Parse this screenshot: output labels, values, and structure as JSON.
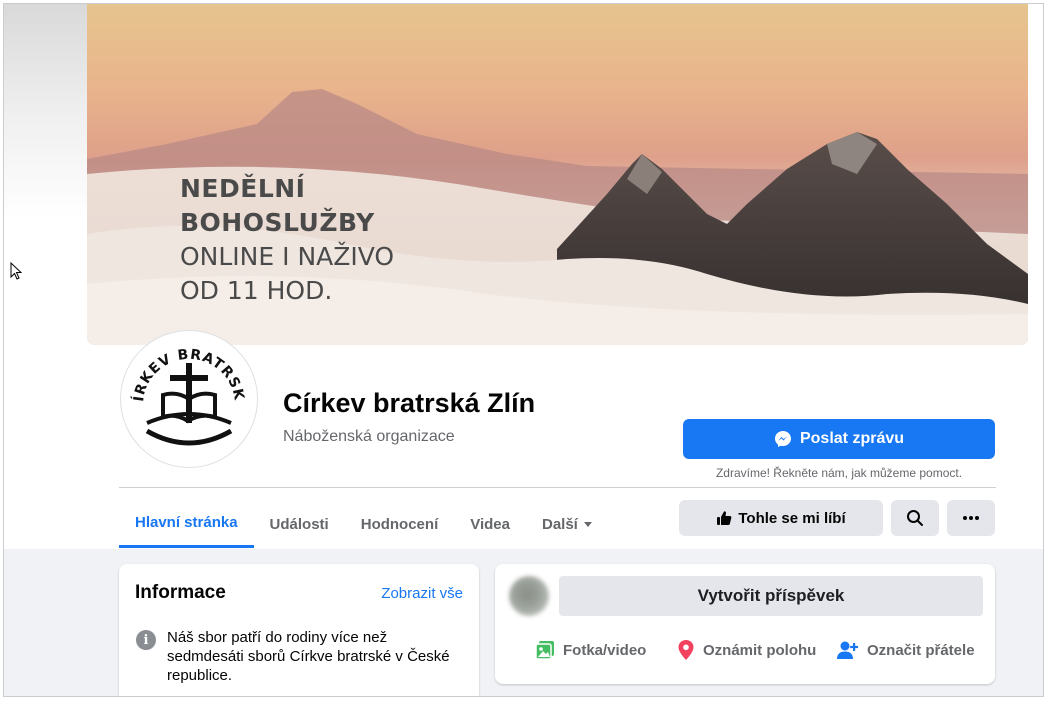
{
  "cover": {
    "line1": "NEDĚLNÍ",
    "line2": "BOHOSLUŽBY",
    "line3": "ONLINE I NAŽIVO",
    "line4": "OD 11 HOD."
  },
  "profile": {
    "logo_text": "CÍRKEV BRATRSKÁ",
    "name": "Církev bratrská Zlín",
    "category": "Náboženská organizace"
  },
  "message": {
    "button_label": "Poslat zprávu",
    "icon": "messenger-icon",
    "hint": "Zdravíme! Řekněte nám, jak můžeme pomoct."
  },
  "tabs": [
    {
      "label": "Hlavní stránka",
      "active": true
    },
    {
      "label": "Události",
      "active": false
    },
    {
      "label": "Hodnocení",
      "active": false
    },
    {
      "label": "Videa",
      "active": false
    },
    {
      "label": "Další",
      "active": false
    }
  ],
  "actions": {
    "like_label": "Tohle se mi líbí",
    "like_icon": "thumbs-up-icon",
    "search_icon": "search-icon",
    "more_icon": "more-icon"
  },
  "info": {
    "title": "Informace",
    "see_all": "Zobrazit vše",
    "description": "Náš sbor patří do rodiny více než sedmdesáti sborů Církve bratrské v České republice."
  },
  "composer": {
    "create_label": "Vytvořit příspěvek",
    "photo_label": "Fotka/video",
    "place_label": "Oznámit polohu",
    "tag_label": "Označit přátele"
  },
  "colors": {
    "accent": "#1877f2",
    "photo_green": "#45bd62",
    "place_red": "#f3425f"
  }
}
